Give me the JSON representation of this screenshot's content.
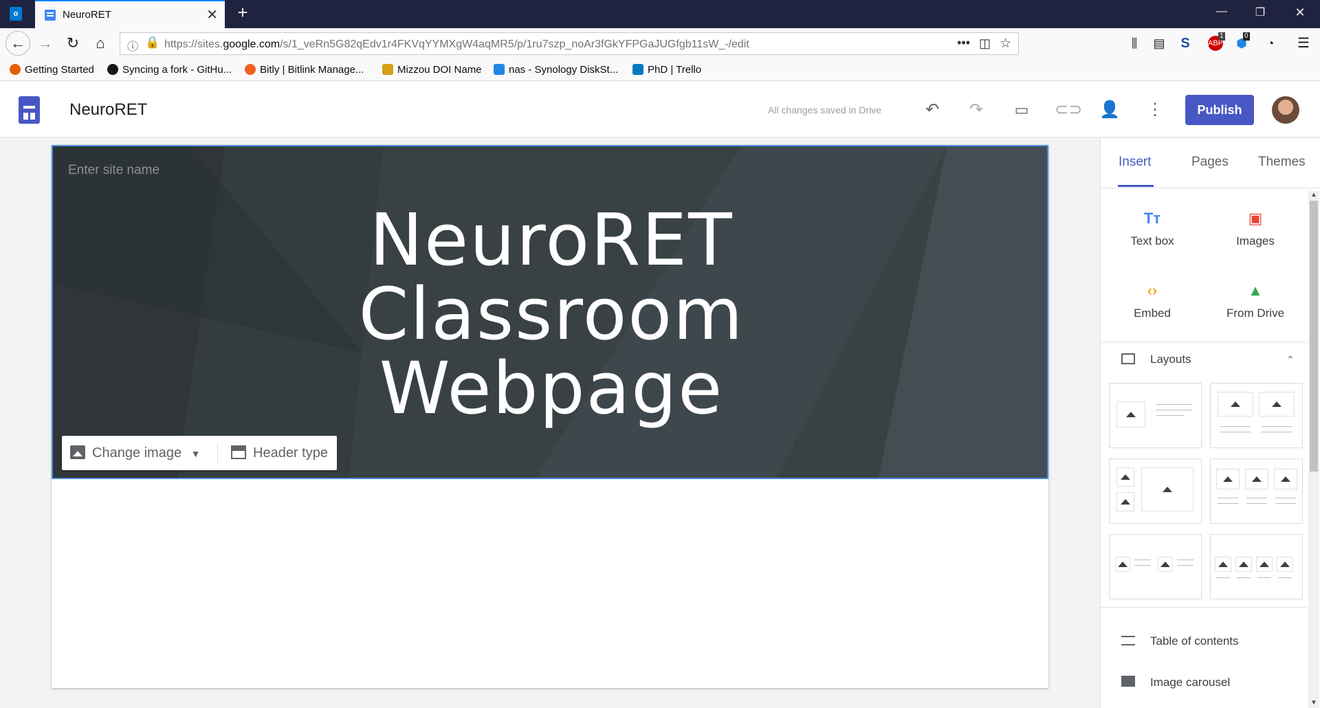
{
  "browser": {
    "tab_title": "NeuroRET",
    "url_prefix": "https://sites.",
    "url_domain": "google.com",
    "url_rest": "/s/1_veRn5G82qEdv1r4FKVqYYMXgW4aqMR5/p/1ru7szp_noAr3fGkYFPGaJUGfgb11sW_-/edit",
    "ext_badge_1": "1",
    "ext_badge_2": "0",
    "bookmarks": [
      {
        "label": "Getting Started",
        "color": "#e66000"
      },
      {
        "label": "Syncing a fork - GitHu...",
        "color": "#181717"
      },
      {
        "label": "Bitly | Bitlink Manage...",
        "color": "#ee6123"
      },
      {
        "label": "Mizzou DOI Name",
        "color": "#d4a017"
      },
      {
        "label": "nas - Synology DiskSt...",
        "color": "#1e88e5"
      },
      {
        "label": "PhD | Trello",
        "color": "#0079bf"
      }
    ]
  },
  "app": {
    "site_title": "NeuroRET",
    "save_status": "All changes saved in Drive",
    "publish_label": "Publish",
    "accent": "#4758c4"
  },
  "banner": {
    "site_name_placeholder": "Enter site name",
    "title_line1": "NeuroRET",
    "title_line2": "Classroom",
    "title_line3": "Webpage",
    "change_image_label": "Change image",
    "header_type_label": "Header type"
  },
  "panel": {
    "tabs": [
      "Insert",
      "Pages",
      "Themes"
    ],
    "insert_items": [
      "Text box",
      "Images",
      "Embed",
      "From Drive"
    ],
    "layouts_label": "Layouts",
    "extras": [
      "Table of contents",
      "Image carousel"
    ]
  }
}
